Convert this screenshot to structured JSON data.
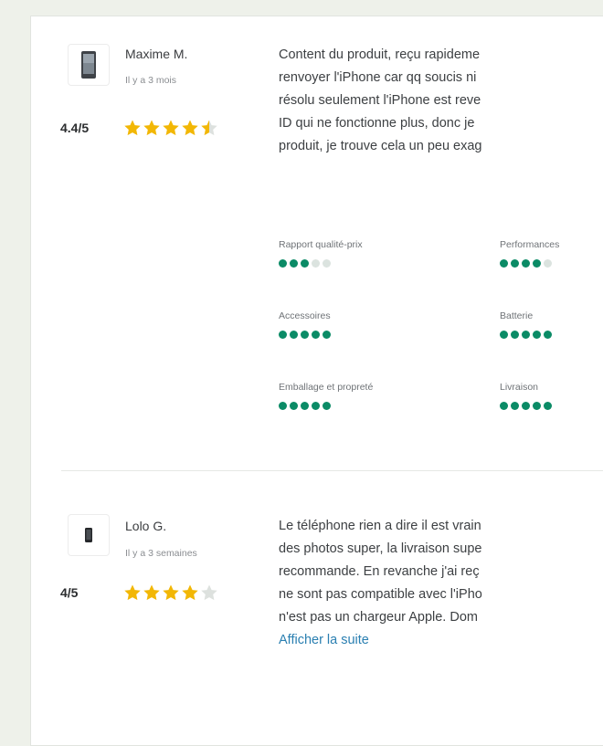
{
  "reviews": [
    {
      "author": "Maxime M.",
      "time_ago": "Il y a 3 mois",
      "score": "4.4/5",
      "rating": 4.5,
      "text_lines": [
        "Content du produit, reçu rapideme",
        "renvoyer l'iPhone car qq soucis ni",
        "résolu seulement l'iPhone est reve",
        "ID qui ne fonctionne plus, donc je",
        "produit, je trouve cela un peu exag"
      ],
      "criteria": [
        {
          "label": "Rapport qualité-prix",
          "value": 3
        },
        {
          "label": "Performances",
          "value": 4
        },
        {
          "label": "Accessoires",
          "value": 5
        },
        {
          "label": "Batterie",
          "value": 5
        },
        {
          "label": "Emballage et propreté",
          "value": 5
        },
        {
          "label": "Livraison",
          "value": 5
        }
      ]
    },
    {
      "author": "Lolo G.",
      "time_ago": "Il y a 3 semaines",
      "score": "4/5",
      "rating": 4,
      "text_lines": [
        "Le téléphone rien a dire il est vrain",
        "des photos super, la livraison supe",
        "recommande. En revanche j'ai reç",
        "ne sont pas compatible avec l'iPho",
        "n'est pas un chargeur Apple. Dom"
      ],
      "show_more": "Afficher la suite"
    }
  ],
  "colors": {
    "star": "#f2b705",
    "star_empty": "#dde1de",
    "rating_dot": "#0b8b66",
    "link": "#2a7fb1"
  },
  "icons": {
    "product_thumbnail": "phone-icon",
    "rating": "star-icon"
  }
}
